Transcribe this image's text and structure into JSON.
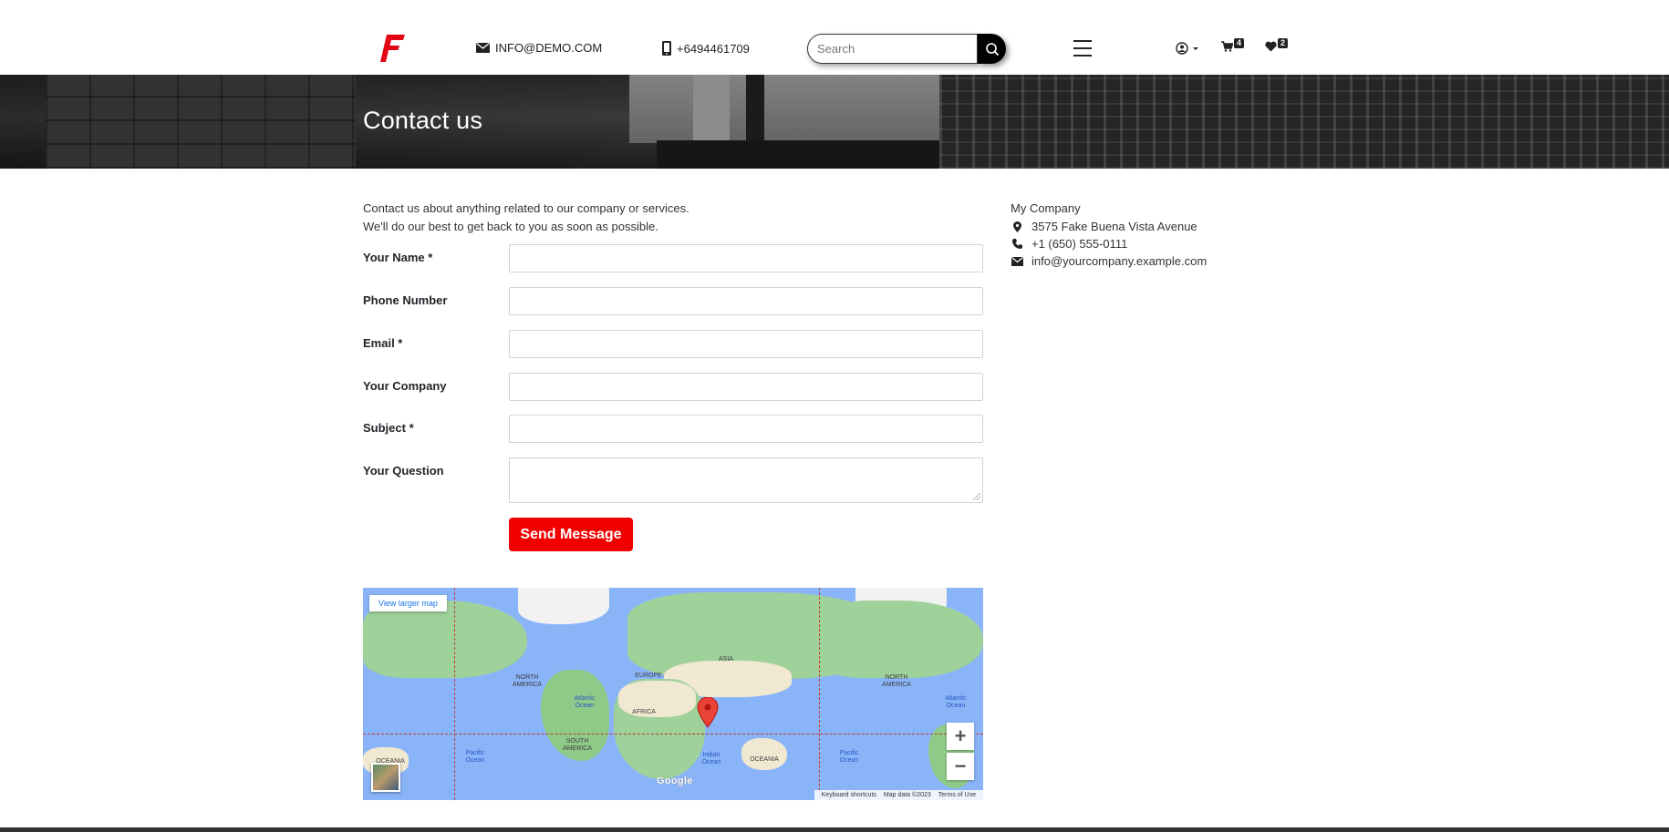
{
  "header": {
    "email": "INFO@DEMO.COM",
    "phone": "+6494461709",
    "search_placeholder": "Search",
    "cart_count": "4",
    "wishlist_count": "2"
  },
  "banner": {
    "title": "Contact us"
  },
  "intro": {
    "line1": "Contact us about anything related to our company or services.",
    "line2": "We'll do our best to get back to you as soon as possible."
  },
  "form": {
    "name_label": "Your Name *",
    "phone_label": "Phone Number",
    "email_label": "Email *",
    "company_label": "Your Company",
    "subject_label": "Subject *",
    "question_label": "Your Question",
    "send_label": "Send Message"
  },
  "map": {
    "view_larger": "View larger map",
    "zoom_in": "+",
    "zoom_out": "−",
    "google": "Google",
    "keyboard": "Keyboard shortcuts",
    "map_data": "Map data ©2023",
    "terms": "Terms of Use",
    "labels": {
      "north_america_l": "NORTH AMERICA",
      "north_america_r": "NORTH AMERICA",
      "south_america": "SOUTH AMERICA",
      "europe": "EUROPE",
      "asia": "ASIA",
      "africa": "AFRICA",
      "oceania_l": "OCEANIA",
      "oceania_m": "OCEANIA",
      "atlantic_l": "Atlantic Ocean",
      "atlantic_r": "Atlantic Ocean",
      "pacific_l": "Pacific Ocean",
      "pacific_r": "Pacific Ocean",
      "indian": "Indian Ocean"
    }
  },
  "company": {
    "name": "My Company",
    "address": "3575 Fake Buena Vista Avenue",
    "phone": "+1 (650) 555-0111",
    "email": "info@yourcompany.example.com"
  }
}
